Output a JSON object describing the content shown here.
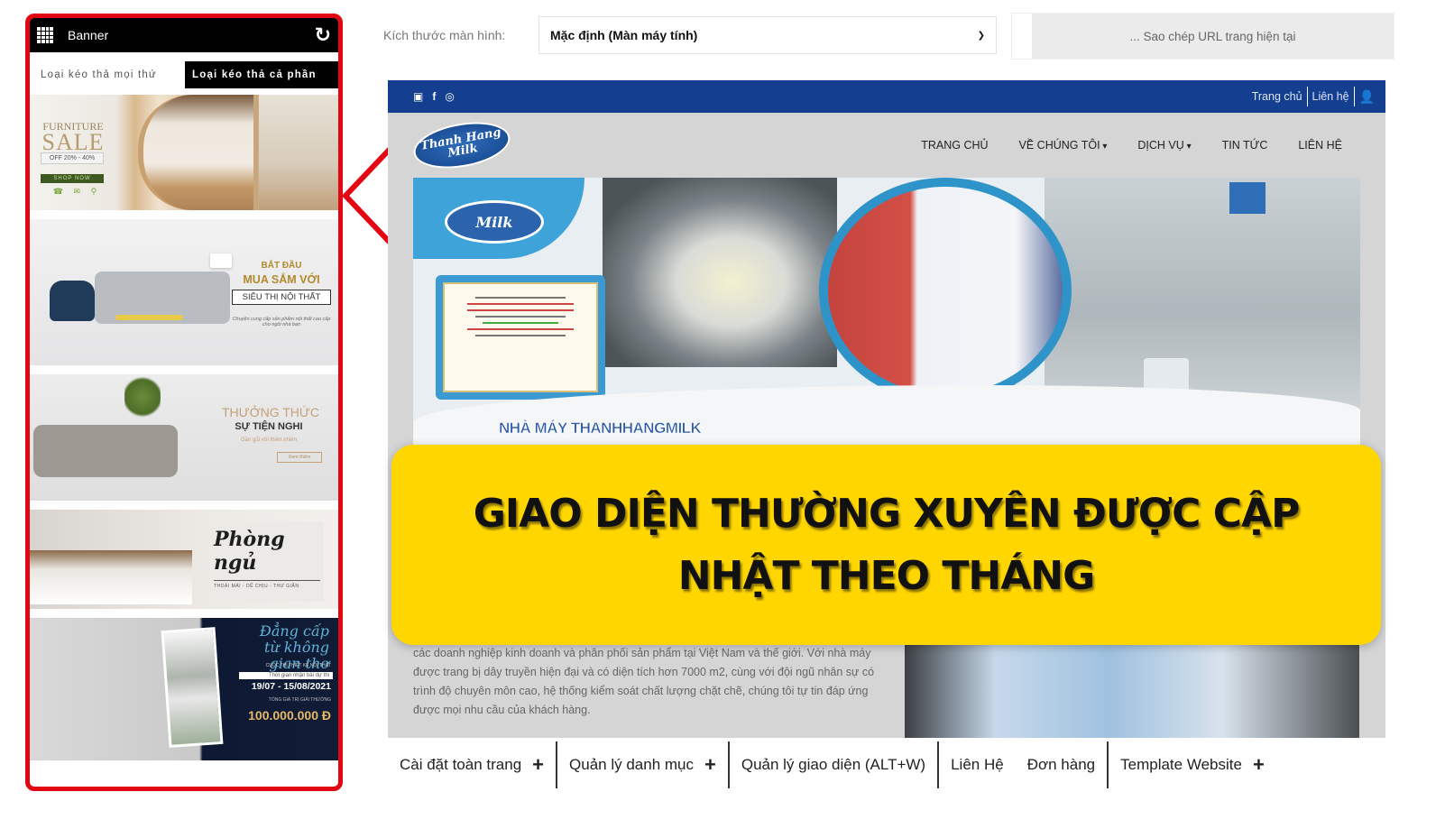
{
  "panel": {
    "title": "Banner",
    "icons": {
      "grid": "grid-icon",
      "reload": "reload-icon"
    },
    "tabs": [
      {
        "label": "Loại kéo thả mọi thứ",
        "active": false
      },
      {
        "label": "Loại kéo thả cả phần",
        "active": true
      }
    ],
    "banners": [
      {
        "name": "furniture-sale",
        "line1": "FURNITURE",
        "line2": "SALE",
        "line3": "OFF 20% - 40%",
        "line4": "SHOP NOW",
        "contact_icons": [
          "☎",
          "✉",
          "⚲"
        ]
      },
      {
        "name": "sieu-thi-noi-that",
        "line1": "BẮT ĐẦU",
        "line2": "MUA SẮM VỚI",
        "line3": "SIÊU THỊ NỘI THẤT",
        "line4": "Chuyên cung cấp sản phẩm nội thất cao cấp cho ngôi nhà bạn"
      },
      {
        "name": "thuong-thuc-su-tien-nghi",
        "line1": "THƯỞNG THỨC",
        "line2": "SỰ TIỆN NGHI",
        "line3": "Gần gũi với thiên nhiên",
        "line4": "Xem thêm"
      },
      {
        "name": "phong-ngu",
        "line1": "Phòng",
        "line2": "ngủ",
        "line3": "THOẢI MÁI - DỄ CHỊU - THƯ GIÃN"
      },
      {
        "name": "dang-cap-khong-gian",
        "line1": "Đẳng cấp",
        "line2": "từ không gian thơ",
        "line3": "CUỘC THI THIẾT KẾ NỘI THẤT",
        "line4": "Thời gian nhận bài dự thi",
        "line5": "19/07 - 15/08/2021",
        "line6": "TỔNG GIÁ TRỊ GIẢI THƯỞNG",
        "line7": "100.000.000 Đ"
      }
    ]
  },
  "controls": {
    "screen_size_label": "Kích thước màn hình:",
    "screen_size_value": "Mặc định (Màn máy tính)",
    "copy_url_label": "... Sao chép URL trang hiện tại"
  },
  "site": {
    "socials": [
      "▣",
      "f",
      "◎"
    ],
    "top_links": [
      "Trang chủ",
      "Liên hệ"
    ],
    "user_icon": "👤",
    "logo_line1": "Thanh Hang",
    "logo_line2": "Milk",
    "nav": [
      {
        "label": "TRANG CHỦ",
        "dropdown": false
      },
      {
        "label": "VỀ CHÚNG TÔI",
        "dropdown": true
      },
      {
        "label": "DỊCH VỤ",
        "dropdown": true
      },
      {
        "label": "TIN TỨC",
        "dropdown": false
      },
      {
        "label": "LIÊN HỆ",
        "dropdown": false
      }
    ],
    "hero_title": "NHÀ MÁY THANHHANGMILK",
    "about_text": "các doanh nghiệp kinh doanh và phân phối sản phẩm tại Việt Nam và thế giới. Với nhà máy được trang bị dây truyền hiện đại và có diện tích hơn 7000 m2, cùng với đội ngũ nhân sự có trình độ chuyên môn cao, hệ thống kiểm soát chất lượng chặt chẽ, chúng tôi tự tin đáp ứng được mọi nhu cầu của khách hàng."
  },
  "overlay": {
    "line1": "GIAO DIỆN THƯỜNG XUYÊN ĐƯỢC CẬP",
    "line2": "NHẬT THEO THÁNG",
    "accent_color": "#ffd600"
  },
  "toolbar": {
    "items": [
      {
        "label": "Cài đặt toàn trang",
        "plus": "+"
      },
      {
        "label": "Quản lý danh mục",
        "plus": "+"
      },
      {
        "label": "Quản lý giao diện (ALT+W)"
      },
      {
        "label": "Liên Hệ"
      },
      {
        "label": "Đơn hàng"
      },
      {
        "label": "Template Website",
        "plus": "+"
      }
    ]
  },
  "colors": {
    "panel_border": "#e30613",
    "site_topbar": "#143f91",
    "highlight_yellow": "#ffd600"
  }
}
